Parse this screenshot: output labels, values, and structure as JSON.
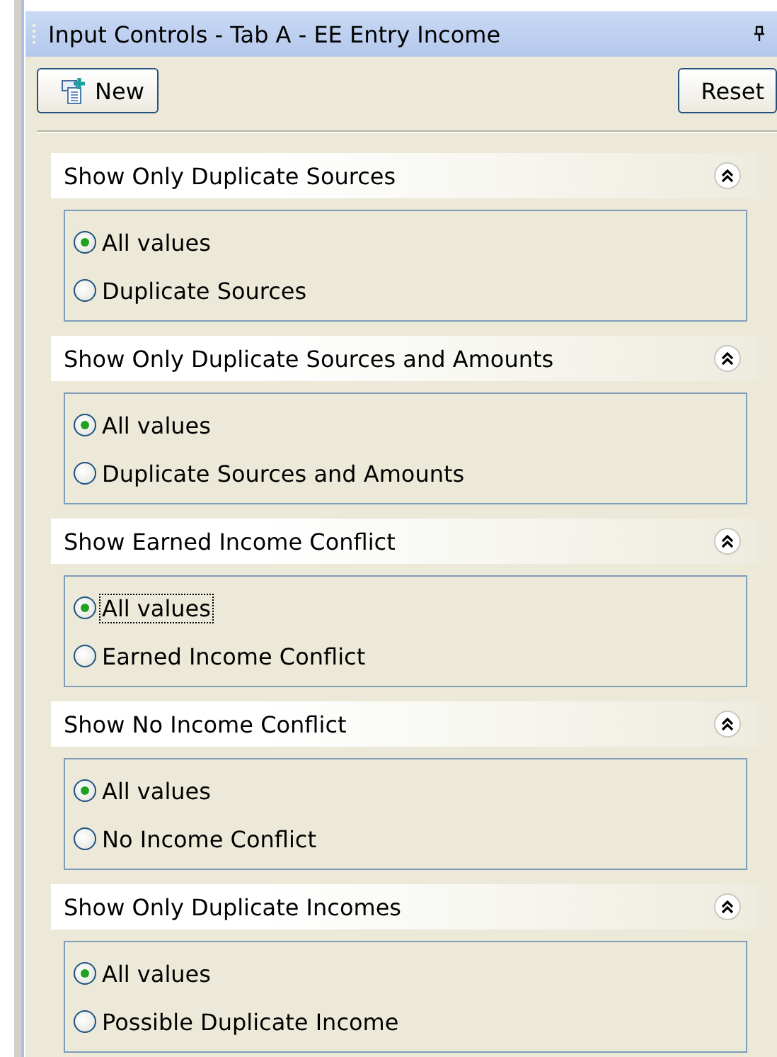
{
  "window": {
    "title": "Input Controls - Tab A - EE Entry Income"
  },
  "toolbar": {
    "new_button": "New",
    "reset_button": "Reset"
  },
  "sections": [
    {
      "title": "Show Only Duplicate Sources",
      "expanded": true,
      "options": [
        {
          "label": "All values",
          "selected": true,
          "focused": false
        },
        {
          "label": "Duplicate Sources",
          "selected": false,
          "focused": false
        }
      ]
    },
    {
      "title": "Show Only Duplicate Sources and Amounts",
      "expanded": true,
      "options": [
        {
          "label": "All values",
          "selected": true,
          "focused": false
        },
        {
          "label": "Duplicate Sources and Amounts",
          "selected": false,
          "focused": false
        }
      ]
    },
    {
      "title": "Show Earned Income Conflict",
      "expanded": true,
      "options": [
        {
          "label": "All values",
          "selected": true,
          "focused": true
        },
        {
          "label": "Earned Income Conflict",
          "selected": false,
          "focused": false
        }
      ]
    },
    {
      "title": "Show No Income Conflict",
      "expanded": true,
      "options": [
        {
          "label": "All values",
          "selected": true,
          "focused": false
        },
        {
          "label": "No Income Conflict",
          "selected": false,
          "focused": false
        }
      ]
    },
    {
      "title": "Show Only Duplicate Incomes",
      "expanded": true,
      "options": [
        {
          "label": "All values",
          "selected": true,
          "focused": false
        },
        {
          "label": "Possible Duplicate Income",
          "selected": false,
          "focused": false
        }
      ]
    }
  ]
}
